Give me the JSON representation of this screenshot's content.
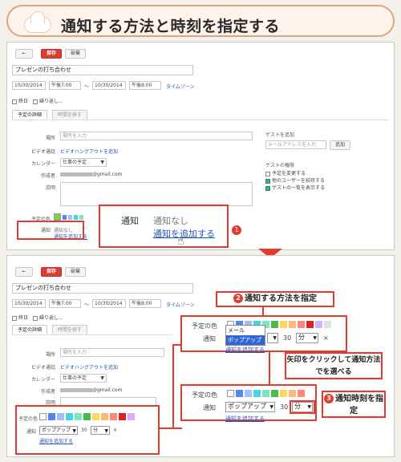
{
  "banner": {
    "title": "通知する方法と時刻を指定する"
  },
  "toolbar": {
    "back": "←",
    "save": "保存",
    "discard": "破棄"
  },
  "event": {
    "title": "プレゼンの打ち合わせ",
    "start_date": "10/30/2014",
    "start_time": "午後7:00",
    "sep": "～",
    "end_date": "10/30/2014",
    "end_time": "午後8:00",
    "timezone": "タイムゾーン",
    "allday": "終日",
    "repeat": "繰り返し..."
  },
  "tabs": {
    "details": "予定の詳細",
    "find_time": "時間を探す"
  },
  "form": {
    "where_label": "場所",
    "where_placeholder": "場所を入力",
    "video_label": "ビデオ通話",
    "video_link": "ビデオハングアウトを追加",
    "calendar_label": "カレンダー",
    "calendar_value": "仕事の予定",
    "creator_label": "作成者",
    "creator_value": "@gmail.com",
    "desc_label": "説明"
  },
  "guests": {
    "title": "ゲストを追加",
    "placeholder": "メールアドレスを入力",
    "add": "追加",
    "perm_title": "ゲストの権限",
    "perm1": "予定を変更する",
    "perm2": "他のユーザーを招待する",
    "perm3": "ゲストの一覧を表示する"
  },
  "colors": {
    "label": "予定の色",
    "list": [
      "#7bd148",
      "#5484ed",
      "#a4bdfc",
      "#46d6db",
      "#7ae7bf",
      "#51b749",
      "#fbd75b",
      "#ffb878",
      "#ff887c",
      "#dc2127",
      "#dbadff",
      "#e1e1e1"
    ]
  },
  "notif": {
    "label": "通知",
    "none": "通知なし",
    "add": "通知を追加する",
    "method_mail": "メール",
    "method_popup": "ポップアップ",
    "value": "30",
    "unit": "分",
    "remove": "×"
  },
  "callouts": {
    "c1_num": "1",
    "c2_num": "2",
    "c2_text": "通知する方法を指定",
    "arrow_tip": "矢印をクリックして通知方法でを選べる",
    "c3_num": "3",
    "c3_text": "通知時刻を指定"
  }
}
